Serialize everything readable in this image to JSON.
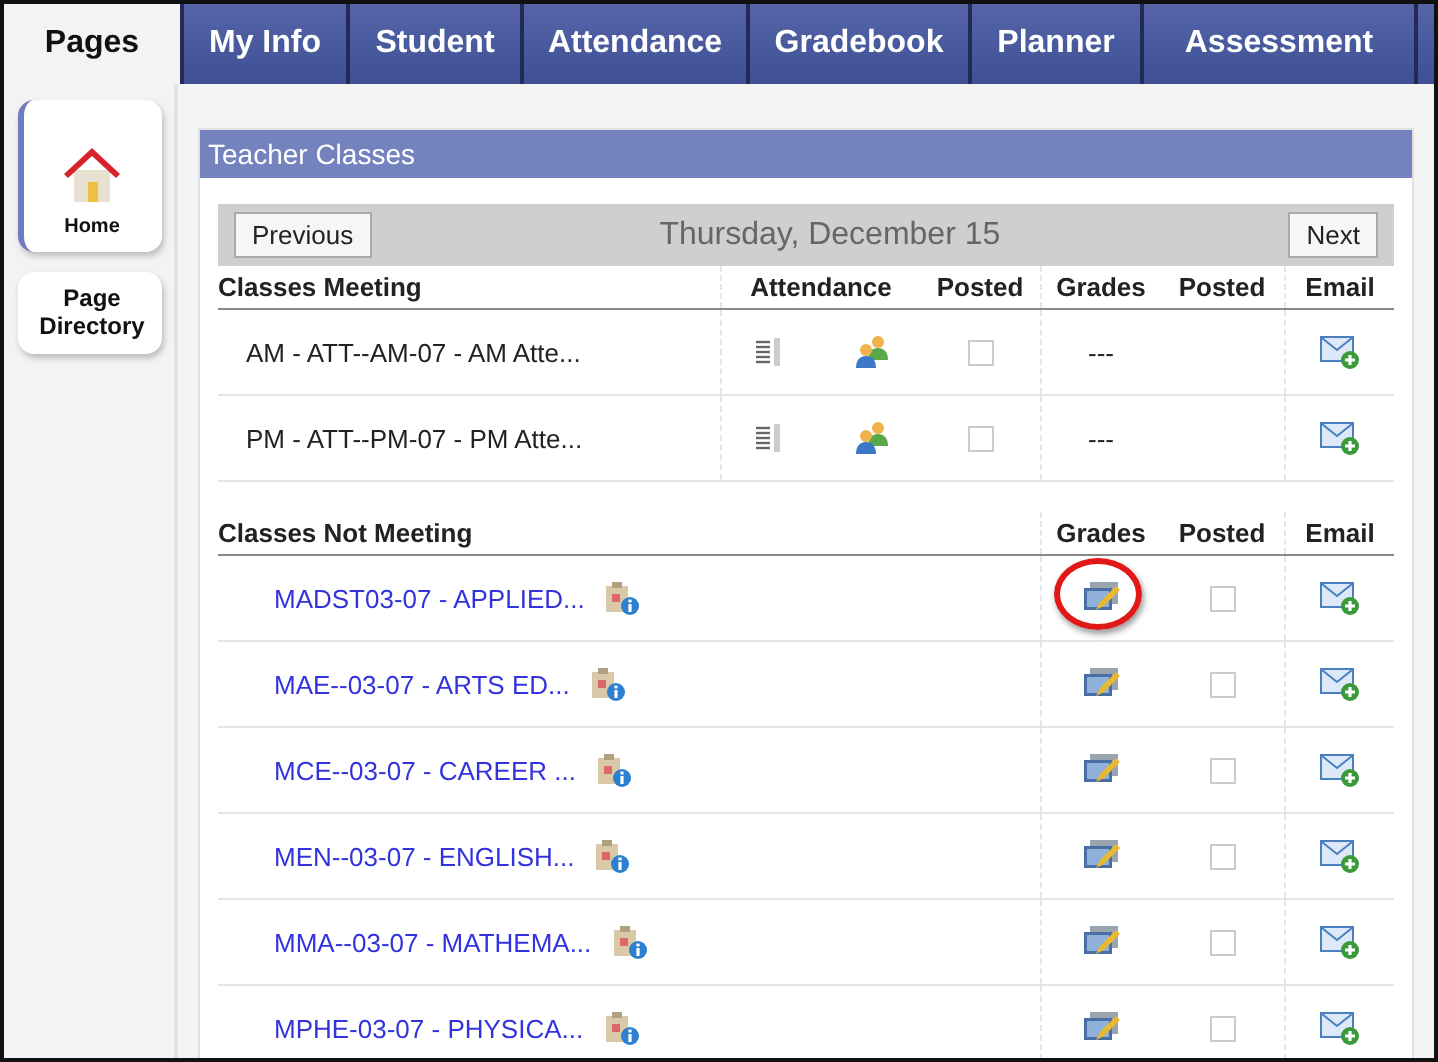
{
  "tabs": [
    {
      "label": "Pages",
      "selected": true
    },
    {
      "label": "My Info",
      "selected": false
    },
    {
      "label": "Student",
      "selected": false
    },
    {
      "label": "Attendance",
      "selected": false
    },
    {
      "label": "Gradebook",
      "selected": false
    },
    {
      "label": "Planner",
      "selected": false
    },
    {
      "label": "Assessment",
      "selected": false
    }
  ],
  "sidebar": {
    "items": [
      {
        "label": "Home",
        "kind": "home",
        "selected": true
      },
      {
        "label": "Page Directory",
        "kind": "plain",
        "selected": false
      }
    ]
  },
  "panel": {
    "title": "Teacher Classes",
    "nav": {
      "previous": "Previous",
      "date": "Thursday, December 15",
      "next": "Next"
    },
    "meeting": {
      "columns": [
        "Classes Meeting",
        "Attendance",
        "Posted",
        "Grades",
        "Posted",
        "Email"
      ],
      "rows": [
        {
          "name": "AM - ATT--AM-07 - AM Atte...",
          "attendance_posted": false,
          "grades": "---"
        },
        {
          "name": "PM - ATT--PM-07 - PM Atte...",
          "attendance_posted": false,
          "grades": "---"
        }
      ]
    },
    "not_meeting": {
      "columns": [
        "Classes Not Meeting",
        "Grades",
        "Posted",
        "Email"
      ],
      "rows": [
        {
          "name": "MADST03-07 - APPLIED...",
          "posted": false,
          "circled": true
        },
        {
          "name": "MAE--03-07 - ARTS ED...",
          "posted": false,
          "circled": false
        },
        {
          "name": "MCE--03-07 - CAREER ...",
          "posted": false,
          "circled": false
        },
        {
          "name": "MEN--03-07 - ENGLISH...",
          "posted": false,
          "circled": false
        },
        {
          "name": "MMA--03-07 - MATHEMA...",
          "posted": false,
          "circled": false
        },
        {
          "name": "MPHE-03-07 - PHYSICA...",
          "posted": false,
          "circled": false
        }
      ]
    }
  }
}
